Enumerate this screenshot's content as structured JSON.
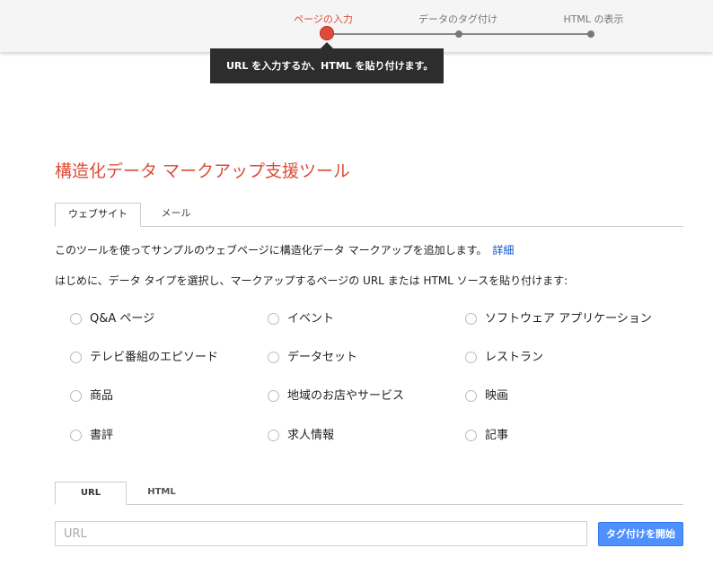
{
  "stepper": {
    "steps": [
      {
        "label": "ページの入力",
        "state": "active"
      },
      {
        "label": "データのタグ付け",
        "state": "pending"
      },
      {
        "label": "HTML の表示",
        "state": "pending"
      }
    ],
    "tooltip": "URL を入力するか、HTML を貼り付けます。"
  },
  "title": "構造化データ マークアップ支援ツール",
  "source_tabs": [
    {
      "label": "ウェブサイト",
      "selected": true
    },
    {
      "label": "メール",
      "selected": false
    }
  ],
  "intro": {
    "text": "このツールを使ってサンプルのウェブページに構造化データ マークアップを追加します。",
    "link": "詳細"
  },
  "instruction": "はじめに、データ タイプを選択し、マークアップするページの URL または HTML ソースを貼り付けます:",
  "data_types": [
    {
      "label": "Q&A ページ",
      "checked": false
    },
    {
      "label": "イベント",
      "checked": false
    },
    {
      "label": "ソフトウェア アプリケーション",
      "checked": false
    },
    {
      "label": "テレビ番組のエピソード",
      "checked": false
    },
    {
      "label": "データセット",
      "checked": false
    },
    {
      "label": "レストラン",
      "checked": false
    },
    {
      "label": "商品",
      "checked": false
    },
    {
      "label": "地域のお店やサービス",
      "checked": false
    },
    {
      "label": "映画",
      "checked": false
    },
    {
      "label": "書評",
      "checked": false
    },
    {
      "label": "求人情報",
      "checked": false
    },
    {
      "label": "記事",
      "checked": false
    }
  ],
  "input_tabs": [
    {
      "label": "URL",
      "selected": true
    },
    {
      "label": "HTML",
      "selected": false
    }
  ],
  "url_input": {
    "value": "",
    "placeholder": "URL"
  },
  "start_button": "タグ付けを開始",
  "colors": {
    "accent": "#dd4b39",
    "link": "#1155cc",
    "button": "#4d90fe",
    "tooltip_bg": "#2d2d2d"
  }
}
